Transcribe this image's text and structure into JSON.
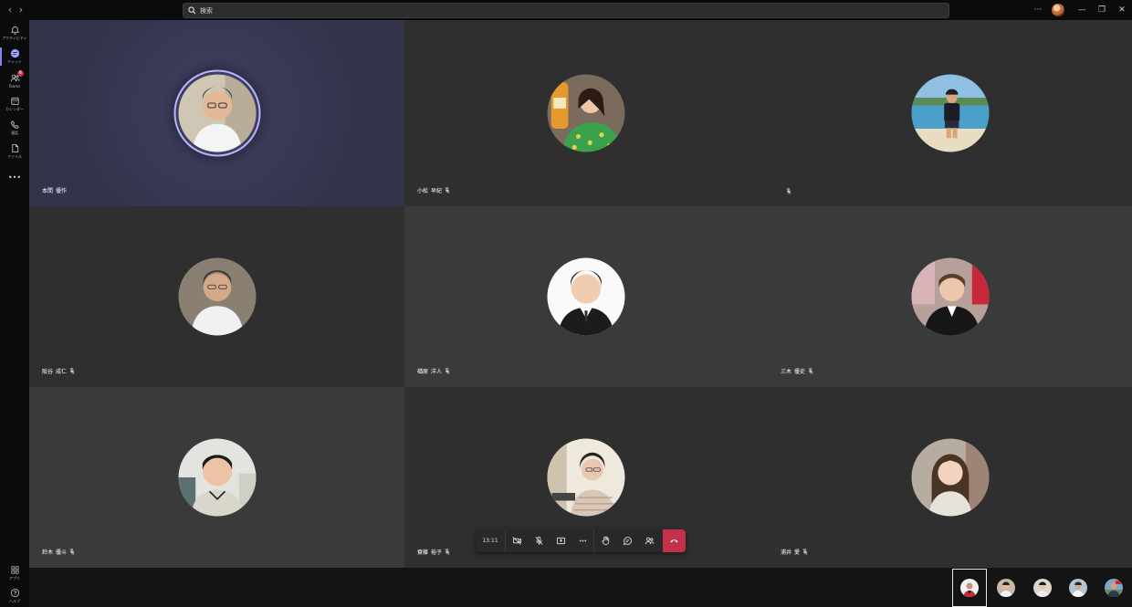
{
  "search": {
    "placeholder": "検索"
  },
  "rail": {
    "items": [
      {
        "label": "アクティビティ",
        "icon": "bell-icon"
      },
      {
        "label": "チャット",
        "icon": "chat-icon"
      },
      {
        "label": "Teams",
        "icon": "teams-icon",
        "badge": "6"
      },
      {
        "label": "カレンダー",
        "icon": "calendar-icon"
      },
      {
        "label": "通話",
        "icon": "phone-icon"
      },
      {
        "label": "ファイル",
        "icon": "file-icon"
      }
    ],
    "more": "•••",
    "apps_label": "アプリ",
    "help_label": "ヘルプ"
  },
  "participants": [
    {
      "first": "本間",
      "last": "優作",
      "muted": false
    },
    {
      "first": "小松",
      "last": "早紀",
      "muted": true
    },
    {
      "first": "",
      "last": "",
      "muted": true
    },
    {
      "first": "阪谷",
      "last": "成仁",
      "muted": true
    },
    {
      "first": "楢原",
      "last": "洋人",
      "muted": true
    },
    {
      "first": "三木",
      "last": "優史",
      "muted": true
    },
    {
      "first": "鈴木",
      "last": "優斗",
      "muted": true
    },
    {
      "first": "齋藤",
      "last": "裕子",
      "muted": true
    },
    {
      "first": "浦井",
      "last": "愛",
      "muted": true
    }
  ],
  "toolbar": {
    "time": "13:11"
  },
  "colors": {
    "accent": "#7f85f5",
    "hangup": "#c4314b",
    "tile": "#2f2f2f",
    "spotlight": "#3a3a58"
  }
}
